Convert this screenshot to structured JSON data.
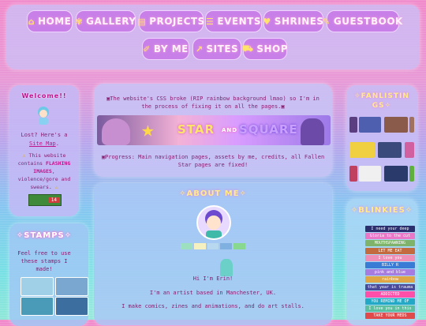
{
  "nav": {
    "row1": [
      {
        "icon": "home-icon",
        "glyph": "⌂",
        "label": "HOME"
      },
      {
        "icon": "palette-icon",
        "glyph": "✾",
        "label": "GALLERY"
      },
      {
        "icon": "projects-icon",
        "glyph": "▤",
        "label": "PROJECTS"
      },
      {
        "icon": "events-icon",
        "glyph": "☰",
        "label": "EVENTS"
      },
      {
        "icon": "heart-icon",
        "glyph": "♥",
        "label": "SHRINES"
      },
      {
        "icon": "guestbook-icon",
        "glyph": "✎",
        "label": "GUESTBOOK"
      }
    ],
    "row2": [
      {
        "icon": "pen-icon",
        "glyph": "✐",
        "label": "BY ME"
      },
      {
        "icon": "link-icon",
        "glyph": "↗",
        "label": "SITES"
      },
      {
        "icon": "cart-icon",
        "glyph": "⛟",
        "label": "SHOP"
      }
    ]
  },
  "welcome": {
    "title": "Welcome!!",
    "lost_text": "Lost? Here's a",
    "sitemap_link": "Site Map",
    "period": ".",
    "warning_prefix": "This website contains",
    "warning_flashing": "FLASHING IMAGES",
    "warning_rest": ", violence/gore and swears.",
    "counter": "14"
  },
  "stamps": {
    "title": "STAMPS",
    "text": "Feel free to use these stamps I made!"
  },
  "notice": {
    "text": "The website's CSS broke (RIP rainbow background lmao) so I'm in the process of fixing it on all the pages.",
    "banner_star": "STAR",
    "banner_and": "AND",
    "banner_square": "SQUARE",
    "progress": "Progress: Main navigation pages, assets by me, credits, all Fallen Star pages are fixed!"
  },
  "about": {
    "title": "ABOUT ME",
    "greeting": "Hi I'm Erin!",
    "location": "I'm an artist based in Manchester, UK.",
    "work": "I make comics, zines and animations, and do art stalls."
  },
  "fanlistings": {
    "title": "FANLISTINGS"
  },
  "blinkies": {
    "title": "BLINKIES",
    "items": [
      {
        "text": "I need your deep",
        "color": "#2b2f6e"
      },
      {
        "text": "Gloria to the cut",
        "color": "#e978c8"
      },
      {
        "text": "MOUTHSPAWNING",
        "color": "#7fb26a"
      },
      {
        "text": "LET ME EAT",
        "color": "#c36a3e"
      },
      {
        "text": "I love you",
        "color": "#ef8fb8"
      },
      {
        "text": "BILLY R",
        "color": "#3a7bd5"
      },
      {
        "text": "pink and blue",
        "color": "#a77ce0"
      },
      {
        "text": "rainbow",
        "color": "#e0a544"
      },
      {
        "text": "that year is trauma",
        "color": "#4a4a9a"
      },
      {
        "text": "ADDICTED",
        "color": "#ff4fa8"
      },
      {
        "text": "YOU REMIND ME OF",
        "color": "#23a9c6"
      },
      {
        "text": "I love you in this",
        "color": "#5bbfa0"
      },
      {
        "text": "TAKE YOUR MEDS",
        "color": "#e04a4a"
      }
    ]
  },
  "colors": {
    "accent": "#c880e8",
    "link": "#c0148c",
    "text": "#8a1f70"
  }
}
